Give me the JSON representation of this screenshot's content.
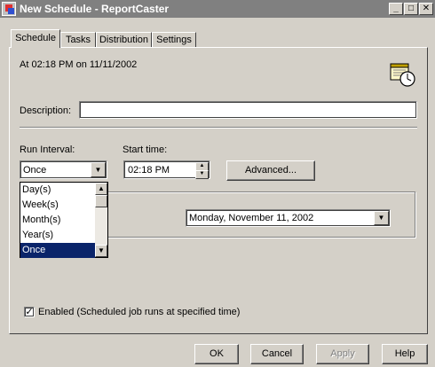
{
  "window": {
    "title": "New Schedule - ReportCaster",
    "buttons": {
      "minimize": "_",
      "maximize": "□",
      "close": "✕"
    }
  },
  "tabs": [
    {
      "label": "Schedule"
    },
    {
      "label": "Tasks"
    },
    {
      "label": "Distribution"
    },
    {
      "label": "Settings"
    }
  ],
  "schedule": {
    "summary": "At 02:18 PM on 11/11/2002",
    "description_label": "Description:",
    "description_value": "",
    "run_interval_label": "Run Interval:",
    "run_interval_value": "Once",
    "run_interval_options": [
      "Day(s)",
      "Week(s)",
      "Month(s)",
      "Year(s)",
      "Once"
    ],
    "start_time_label": "Start time:",
    "start_time_value": "02:18 PM",
    "advanced_label": "Advanced...",
    "date_value": "Monday, November 11, 2002",
    "enabled_label": "Enabled (Scheduled job runs at specified time)",
    "enabled_checked": true
  },
  "footer": {
    "ok": "OK",
    "cancel": "Cancel",
    "apply": "Apply",
    "help": "Help"
  },
  "icons": {
    "dropdown_arrow": "▼",
    "scroll_up": "▲",
    "scroll_down": "▼",
    "spin_up": "▲",
    "spin_down": "▼",
    "checkmark": "✓"
  }
}
